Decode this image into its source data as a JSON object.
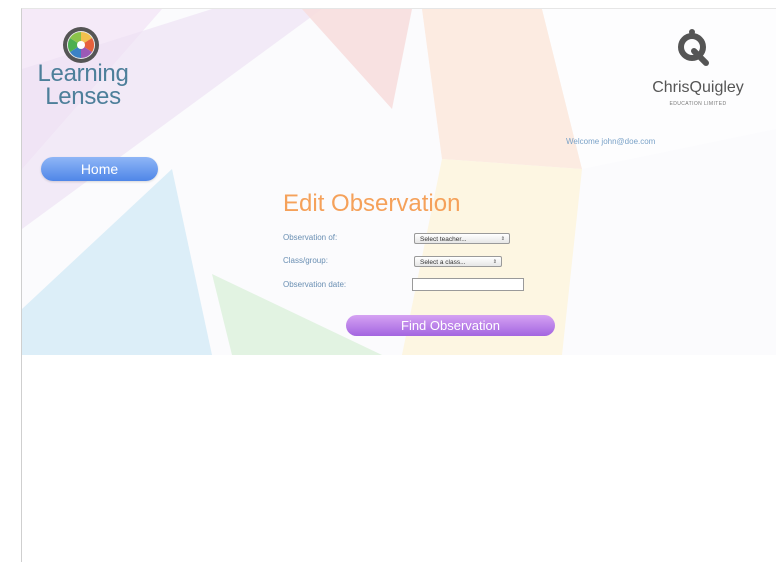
{
  "brand": {
    "name_line1": "Learning",
    "name_line2": "Lenses",
    "partner_name": "ChrisQuigley",
    "partner_sub": "EDUCATION LIMITED"
  },
  "header": {
    "welcome": "Welcome john@doe.com"
  },
  "nav": {
    "home_label": "Home"
  },
  "form": {
    "title": "Edit Observation",
    "observation_of_label": "Observation of:",
    "teacher_select_value": "Select teacher...",
    "class_label": "Class/group:",
    "class_select_value": "Select a class...",
    "date_label": "Observation date:",
    "date_value": "",
    "find_button_label": "Find Observation"
  },
  "colors": {
    "accent_blue": "#4f86e8",
    "title_orange": "#f5a15a",
    "button_purple": "#a365e0",
    "label_blue": "#6a8fb3"
  },
  "icons": {
    "logo": "camera-lens-icon",
    "partner_logo": "chris-quigley-logo-icon",
    "select_arrow": "updown-arrow-icon"
  }
}
